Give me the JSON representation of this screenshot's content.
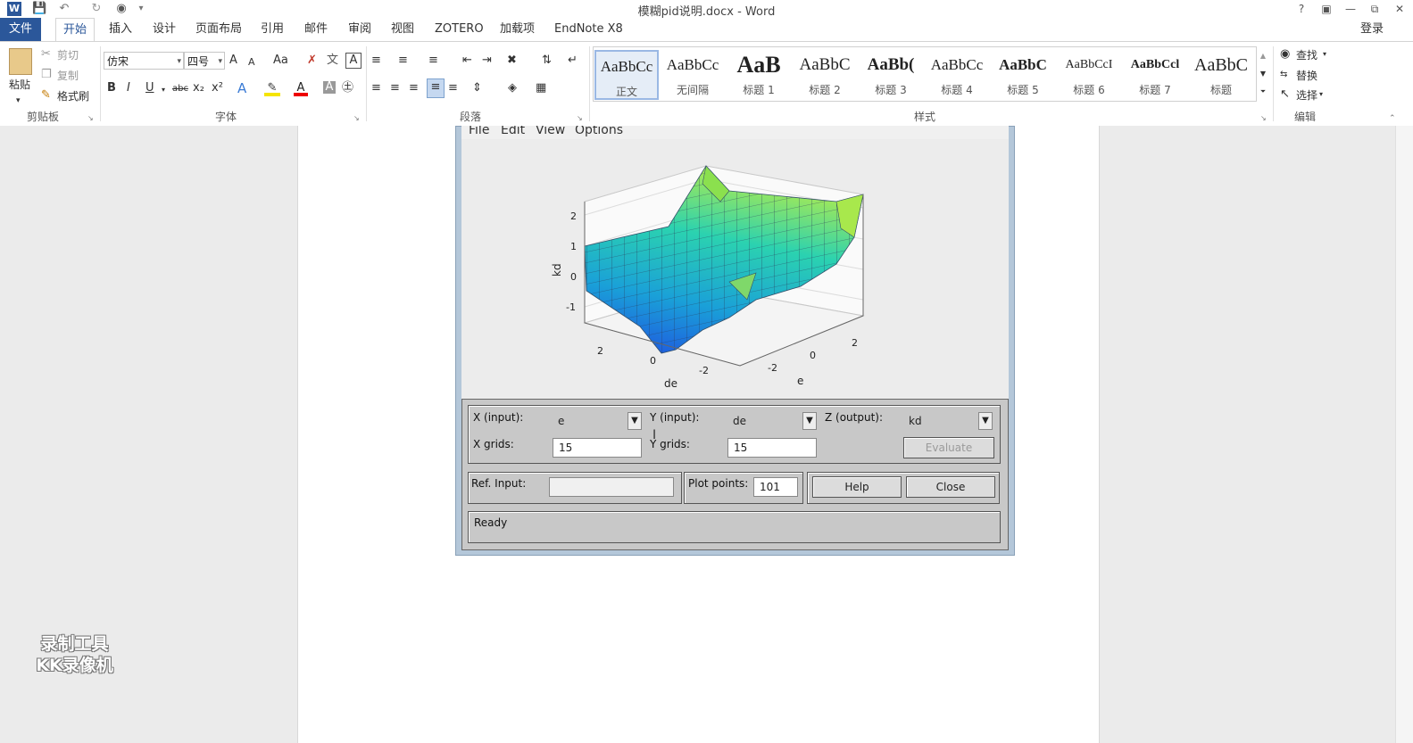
{
  "window": {
    "title": "模糊pid说明.docx - Word",
    "help": "?",
    "sign_in": "登录"
  },
  "tabs": [
    "文件",
    "开始",
    "插入",
    "设计",
    "页面布局",
    "引用",
    "邮件",
    "审阅",
    "视图",
    "ZOTERO",
    "加载项",
    "EndNote X8"
  ],
  "ribbon": {
    "clipboard": {
      "paste": "粘贴",
      "cut": "剪切",
      "copy": "复制",
      "format_painter": "格式刷",
      "label": "剪贴板"
    },
    "font": {
      "family": "仿宋",
      "size": "四号",
      "label": "字体",
      "bold": "B",
      "italic": "I",
      "underline": "U",
      "strike": "abc",
      "sub": "x₂",
      "sup": "x²",
      "grow": "A",
      "shrink": "A",
      "case": "Aa"
    },
    "paragraph": {
      "label": "段落"
    },
    "styles": {
      "label": "样式",
      "items": [
        {
          "sample": "AaBbCc",
          "name": "正文"
        },
        {
          "sample": "AaBbCc",
          "name": "无间隔"
        },
        {
          "sample": "AaB",
          "name": "标题 1"
        },
        {
          "sample": "AaBbC",
          "name": "标题 2"
        },
        {
          "sample": "AaBb(",
          "name": "标题 3"
        },
        {
          "sample": "AaBbCc",
          "name": "标题 4"
        },
        {
          "sample": "AaBbC",
          "name": "标题 5"
        },
        {
          "sample": "AaBbCcI",
          "name": "标题 6"
        },
        {
          "sample": "AaBbCcl",
          "name": "标题 7"
        },
        {
          "sample": "AaBbC",
          "name": "标题"
        }
      ]
    },
    "editing": {
      "find": "查找",
      "replace": "替换",
      "select": "选择",
      "label": "编辑"
    }
  },
  "figure": {
    "menus": [
      "File",
      "Edit",
      "View",
      "Options"
    ],
    "plot": {
      "zlabel": "kd",
      "xlabel": "de",
      "ylabel": "e",
      "zticks": [
        "2",
        "1",
        "0",
        "-1"
      ],
      "de_ticks": [
        "2",
        "0",
        "-2"
      ],
      "e_ticks": [
        "-2",
        "0",
        "2"
      ]
    },
    "controls": {
      "x_input_label": "X (input):",
      "x_input_value": "e",
      "y_input_label": "Y (input):",
      "y_input_value": "de",
      "z_output_label": "Z (output):",
      "z_output_value": "kd",
      "x_grids_label": "X grids:",
      "x_grids_value": "15",
      "y_grids_label": "Y grids:",
      "y_grids_value": "15",
      "evaluate": "Evaluate",
      "ref_input_label": "Ref. Input:",
      "ref_input_value": "",
      "plot_points_label": "Plot points:",
      "plot_points_value": "101",
      "help": "Help",
      "close": "Close",
      "status": "Ready"
    }
  },
  "watermark": {
    "line1": "录制工具",
    "line2": "KK录像机"
  }
}
